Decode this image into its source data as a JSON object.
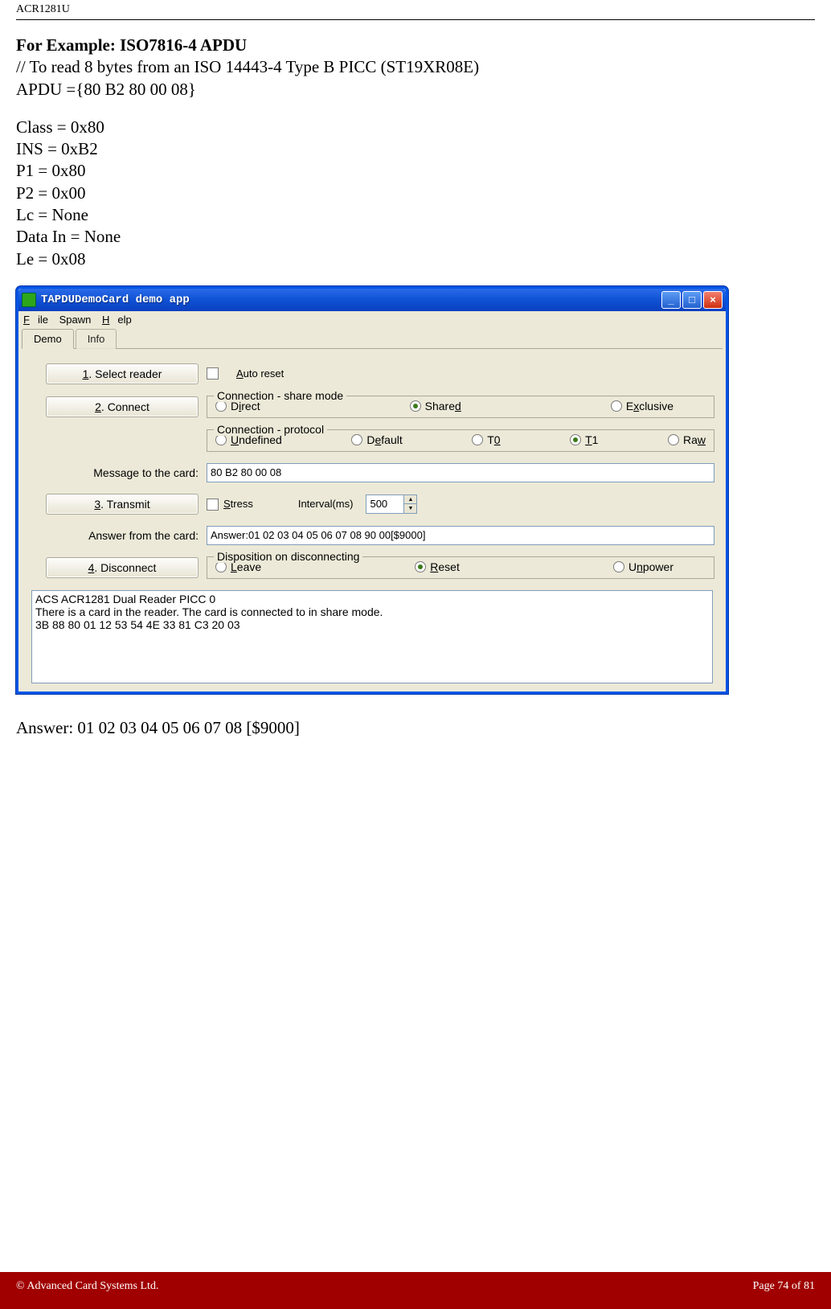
{
  "header": {
    "doc_id": "ACR1281U"
  },
  "text": {
    "heading": "For Example: ISO7816-4 APDU",
    "line_comment": "// To read 8 bytes from an ISO 14443-4 Type B PICC (ST19XR08E)",
    "apdu_line": "APDU ={80 B2 80 00 08}",
    "p_class": "Class = 0x80",
    "p_ins": "INS = 0xB2",
    "p_p1": "P1 = 0x80",
    "p_p2": "P2 = 0x00",
    "p_lc": "Lc = None",
    "p_datain": "Data In = None",
    "p_le": "Le = 0x08",
    "answer": "Answer:  01 02 03 04 05 06 07 08 [$9000]"
  },
  "window": {
    "title": "TAPDUDemoCard demo app",
    "menu": {
      "file": "File",
      "spawn": "Spawn",
      "help": "Help"
    },
    "tabs": {
      "demo": "Demo",
      "info": "Info"
    },
    "buttons": {
      "select_reader": "1. Select reader",
      "connect": "2. Connect",
      "transmit": "3. Transmit",
      "disconnect": "4. Disconnect"
    },
    "checkboxes": {
      "auto_reset": "Auto reset",
      "stress": "Stress"
    },
    "groups": {
      "share_mode": {
        "legend": "Connection - share mode",
        "direct": "Direct",
        "shared": "Shared",
        "exclusive": "Exclusive"
      },
      "protocol": {
        "legend": "Connection - protocol",
        "undefined": "Undefined",
        "default": "Default",
        "t0": "T0",
        "t1": "T1",
        "raw": "Raw"
      },
      "disposition": {
        "legend": "Disposition on disconnecting",
        "leave": "Leave",
        "reset": "Reset",
        "unpower": "Unpower"
      }
    },
    "labels": {
      "message": "Message to the card:",
      "interval": "Interval(ms)",
      "answer_from": "Answer from the card:"
    },
    "values": {
      "message_input": "80 B2 80 00 08",
      "interval": "500",
      "answer_input": "Answer:01 02 03 04 05 06 07 08 90 00[$9000]"
    },
    "log": "ACS ACR1281 Dual Reader PICC 0\nThere is a card in the reader. The card is connected to in share mode.\n3B 88 80 01 12 53 54 4E 33 81 C3 20 03"
  },
  "footer": {
    "left": "© Advanced Card Systems Ltd.",
    "right": "Page 74 of 81"
  }
}
